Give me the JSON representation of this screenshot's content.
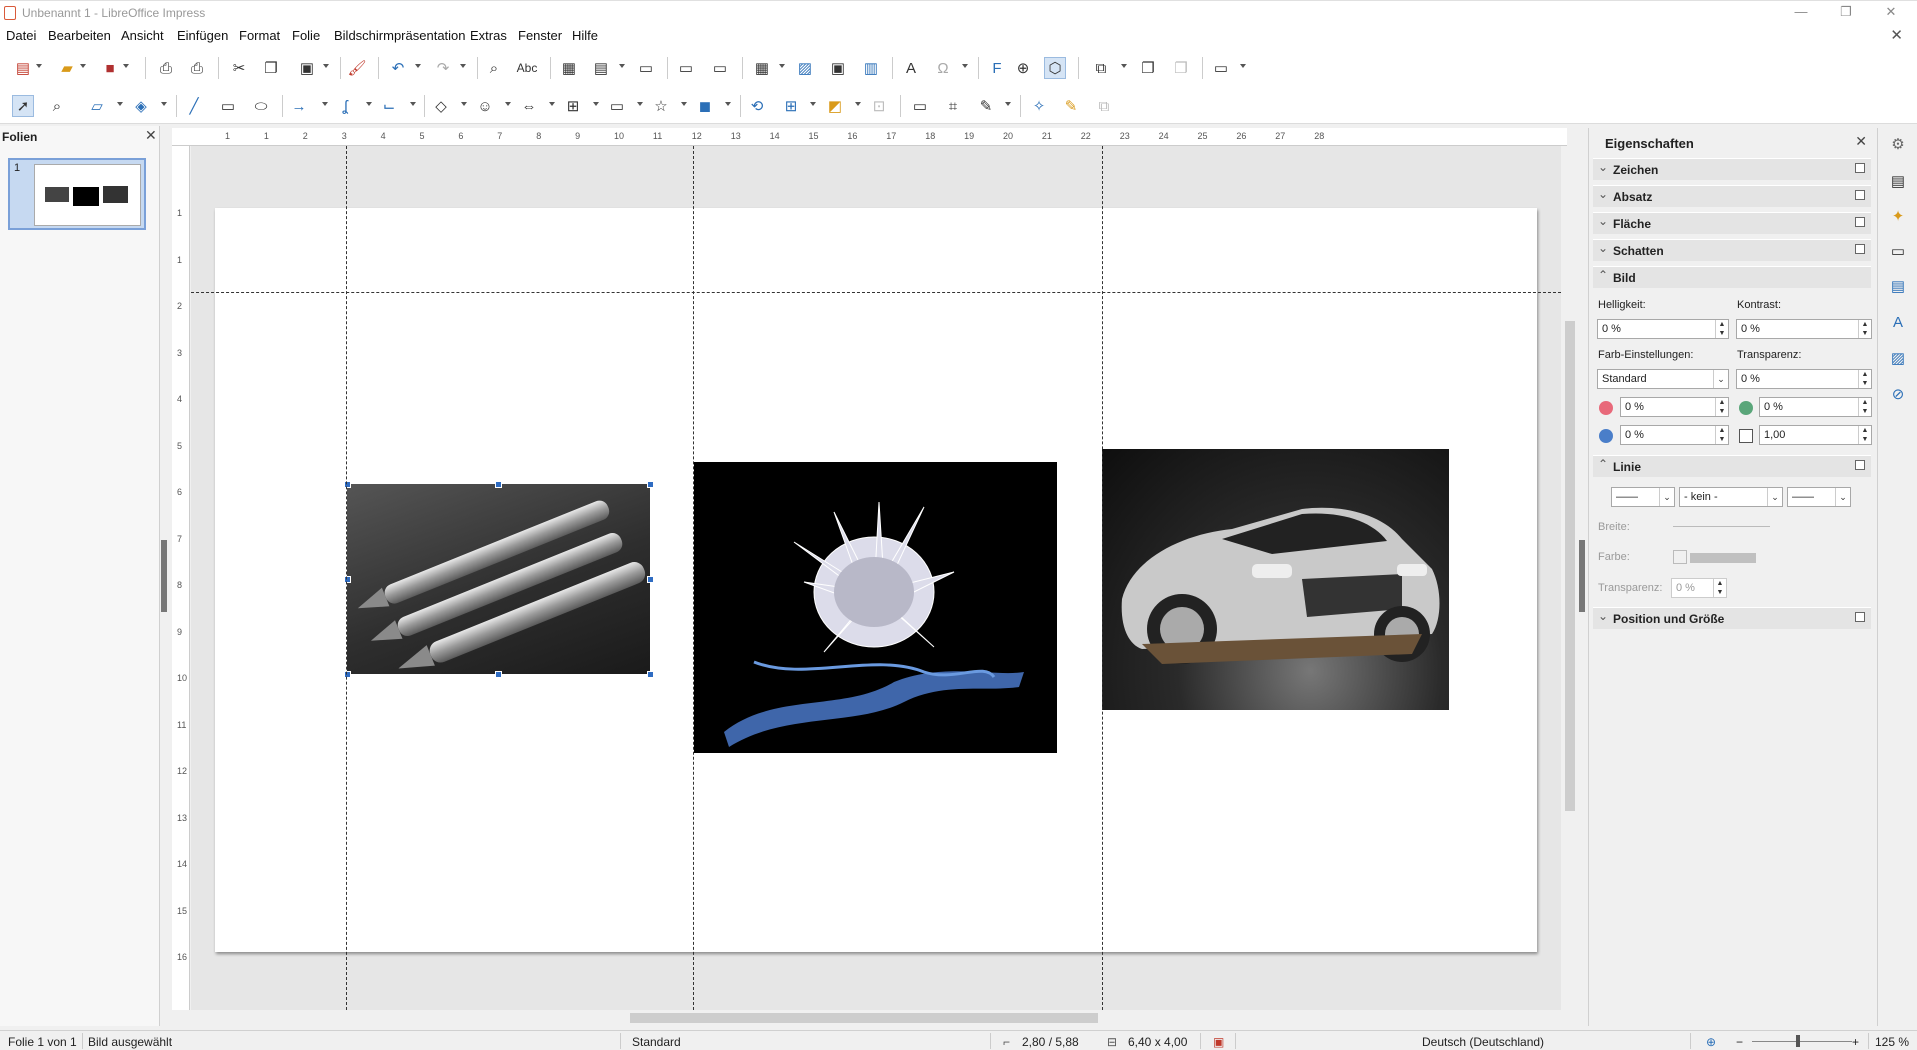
{
  "window": {
    "title": "Unbenannt 1 - LibreOffice Impress",
    "minimize": "—",
    "maximize": "❐",
    "close": "✕",
    "doc_close": "✕"
  },
  "menu": [
    "Datei",
    "Bearbeiten",
    "Ansicht",
    "Einfügen",
    "Format",
    "Folie",
    "Bildschirmpräsentation",
    "Extras",
    "Fenster",
    "Hilfe"
  ],
  "slides_pane": {
    "header": "Folien",
    "close": "✕",
    "slide_number": "1"
  },
  "ruler": {
    "h_numbers": [
      "1",
      "1",
      "2",
      "3",
      "4",
      "5",
      "6",
      "7",
      "8",
      "9",
      "10",
      "11",
      "12",
      "13",
      "14",
      "15",
      "16",
      "17",
      "18",
      "19",
      "20",
      "21",
      "22",
      "23",
      "24",
      "25",
      "26",
      "27",
      "28"
    ],
    "v_numbers": [
      "1",
      "1",
      "2",
      "3",
      "4",
      "5",
      "6",
      "7",
      "8",
      "9",
      "10",
      "11",
      "12",
      "13",
      "14",
      "15",
      "16"
    ]
  },
  "sidebar": {
    "title": "Eigenschaften",
    "close": "✕",
    "sections": {
      "zeichen": "Zeichen",
      "absatz": "Absatz",
      "flaeche": "Fläche",
      "schatten": "Schatten",
      "bild": "Bild",
      "linie": "Linie",
      "position": "Position und Größe"
    },
    "bild": {
      "helligkeit_label": "Helligkeit:",
      "helligkeit": "0 %",
      "kontrast_label": "Kontrast:",
      "kontrast": "0 %",
      "farb_label": "Farb-Einstellungen:",
      "farb": "Standard",
      "transparenz_label": "Transparenz:",
      "transparenz": "0 %",
      "rot": "0 %",
      "gruen": "0 %",
      "blau": "0 %",
      "gamma": "1,00"
    },
    "linie": {
      "arrow_start": "——",
      "style": "- kein -",
      "arrow_end": "——",
      "breite_label": "Breite:",
      "farbe_label": "Farbe:",
      "transparenz_label": "Transparenz:",
      "transparenz": "0 %"
    },
    "colors": {
      "red": "#e8697a",
      "green": "#5aa67a",
      "blue": "#4a7ec9"
    }
  },
  "status": {
    "slide": "Folie 1 von 1",
    "selection": "Bild ausgewählt",
    "layout": "Standard",
    "position": "2,80 / 5,88",
    "size": "6,40 x 4,00",
    "language": "Deutsch (Deutschland)",
    "zoom": "125 %",
    "zoom_minus": "−",
    "zoom_plus": "+"
  }
}
